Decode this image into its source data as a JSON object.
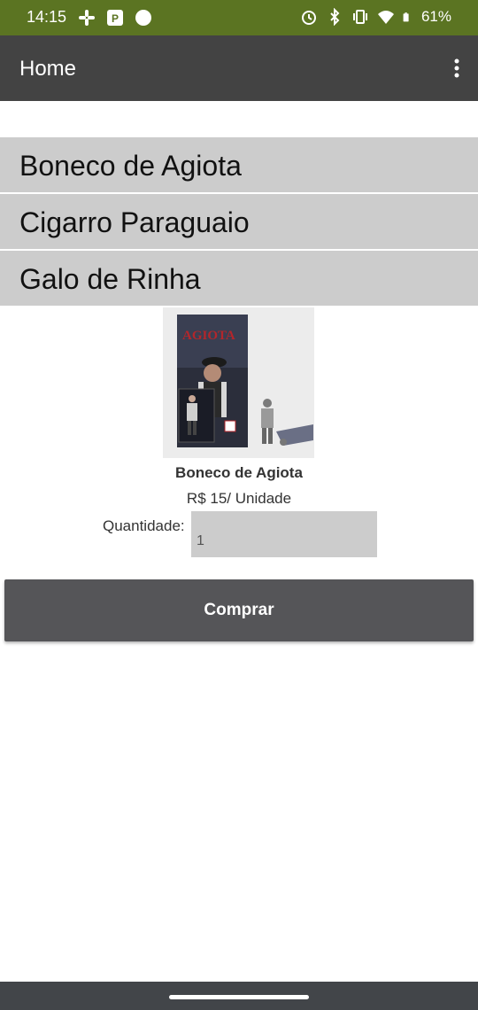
{
  "status_bar": {
    "time": "14:15",
    "battery": "61%",
    "left_icons": [
      "slack-icon",
      "p-app-icon",
      "cloud-icon"
    ],
    "right_icons": [
      "alarm-icon",
      "bluetooth-icon",
      "vibrate-icon",
      "wifi-icon",
      "battery-icon"
    ]
  },
  "app_bar": {
    "title": "Home",
    "menu_icon": "more-vert-icon"
  },
  "products": [
    {
      "label": "Boneco de Agiota"
    },
    {
      "label": "Cigarro Paraguaio"
    },
    {
      "label": "Galo de Rinha"
    }
  ],
  "detail": {
    "name": "Boneco de Agiota",
    "price": "R$ 15/ Unidade",
    "quantity_label": "Quantidade:",
    "quantity_value": "1",
    "image_text": "AGIOTA"
  },
  "actions": {
    "buy_label": "Comprar"
  },
  "colors": {
    "status_bar": "#5b7422",
    "app_bar": "#434343",
    "list_item": "#cccccc",
    "button": "#555558",
    "nav_bar": "#424549"
  }
}
